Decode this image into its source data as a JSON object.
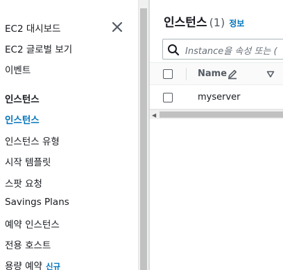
{
  "sidebar": {
    "items": [
      {
        "label": "EC2 대시보드"
      },
      {
        "label": "EC2 글로벌 보기"
      },
      {
        "label": "이벤트"
      }
    ],
    "section_instances": {
      "title": "인스턴스",
      "items": [
        {
          "label": "인스턴스",
          "active": true
        },
        {
          "label": "인스턴스 유형"
        },
        {
          "label": "시작 템플릿"
        },
        {
          "label": "스팟 요청"
        },
        {
          "label": "Savings Plans"
        },
        {
          "label": "예약 인스턴스"
        },
        {
          "label": "전용 호스트"
        },
        {
          "label": "용량 예약",
          "badge": "신규"
        }
      ]
    },
    "close_icon": "close-icon"
  },
  "main": {
    "title": "인스턴스",
    "count": "(1)",
    "info_link": "정보",
    "search": {
      "placeholder": "Instance을 속성 또는 (",
      "icon": "search-icon"
    },
    "table": {
      "columns": [
        {
          "label": "Name",
          "editable": true,
          "sortable": true
        }
      ],
      "rows": [
        {
          "name": "myserver"
        }
      ]
    }
  },
  "colors": {
    "accent": "#0073bb",
    "text": "#16191f",
    "muted": "#545b64",
    "border": "#aab7b8"
  }
}
